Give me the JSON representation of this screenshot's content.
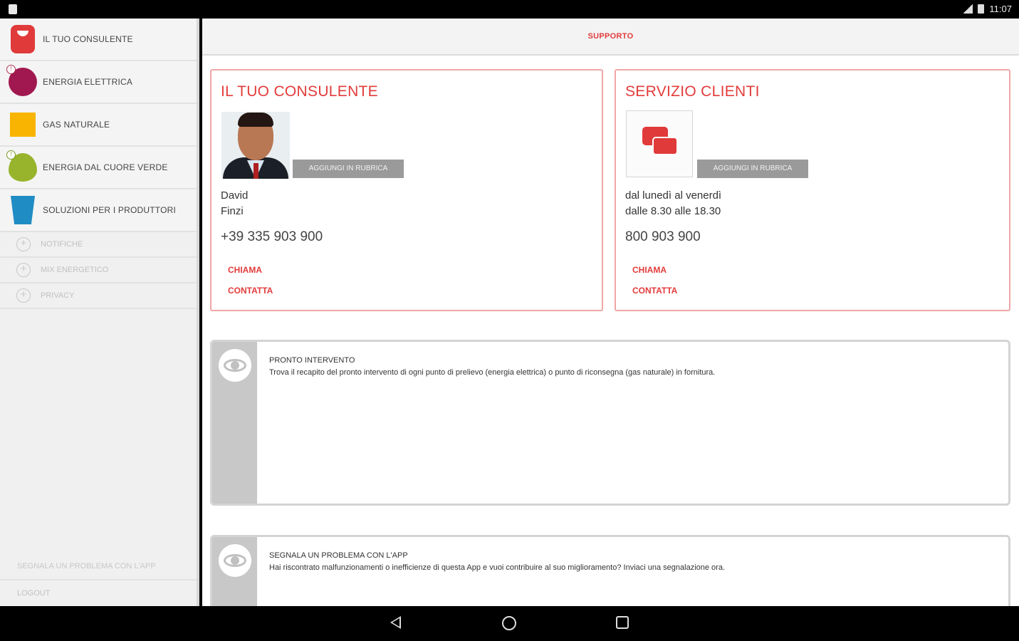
{
  "status_bar": {
    "time": "11:07"
  },
  "sidebar": {
    "items": [
      {
        "label": "IL TUO CONSULENTE"
      },
      {
        "label": "ENERGIA ELETTRICA",
        "badge": "!"
      },
      {
        "label": "GAS NATURALE"
      },
      {
        "label": "ENERGIA DAL CUORE VERDE",
        "badge": "!"
      },
      {
        "label": "SOLUZIONI PER I PRODUTTORI"
      }
    ],
    "sub_items": [
      {
        "label": "NOTIFICHE"
      },
      {
        "label": "MIX ENERGETICO"
      },
      {
        "label": "PRIVACY"
      }
    ],
    "report_label": "SEGNALA UN PROBLEMA CON L'APP",
    "logout_label": "LOGOUT"
  },
  "header": {
    "title": "SUPPORTO"
  },
  "consultant_card": {
    "title": "IL TUO CONSULENTE",
    "button": "AGGIUNGI IN RUBRICA",
    "first_name": "David",
    "last_name": "Finzi",
    "phone": "+39 335 903 900",
    "call": "CHIAMA",
    "contact": "CONTATTA"
  },
  "service_card": {
    "title": "SERVIZIO CLIENTI",
    "button": "AGGIUNGI IN RUBRICA",
    "hours_line1": "dal lunedì al venerdì",
    "hours_line2": "dalle 8.30 alle 18.30",
    "phone": "800 903 900",
    "call": "CHIAMA",
    "contact": "CONTATTA"
  },
  "info_cards": [
    {
      "title": "PRONTO INTERVENTO",
      "description": "Trova il recapito del pronto intervento di ogni punto di prelievo (energia elettrica) o punto di riconsegna (gas naturale) in fornitura."
    },
    {
      "title": "SEGNALA UN PROBLEMA CON L'APP",
      "description": "Hai riscontrato malfunzionamenti o inefficienze di questa App e vuoi contribuire al suo miglioramento? Inviaci una segnalazione ora."
    }
  ],
  "colors": {
    "accent": "#e33b3b",
    "card_border": "#f0a6a6"
  }
}
